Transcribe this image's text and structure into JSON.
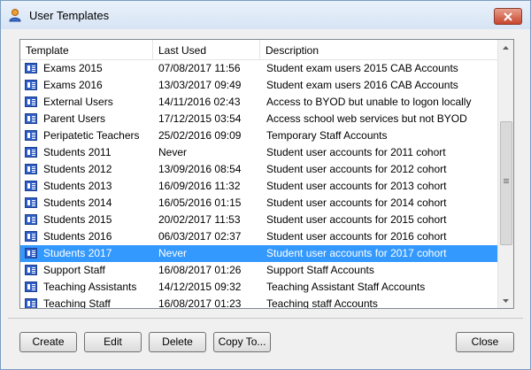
{
  "window": {
    "title": "User Templates"
  },
  "list": {
    "columns": [
      "Template",
      "Last Used",
      "Description"
    ],
    "rows": [
      {
        "template": "Exams 2015",
        "last_used": "07/08/2017 11:56",
        "description": "Student exam users 2015 CAB Accounts"
      },
      {
        "template": "Exams 2016",
        "last_used": "13/03/2017 09:49",
        "description": "Student exam users 2016 CAB Accounts"
      },
      {
        "template": "External Users",
        "last_used": "14/11/2016 02:43",
        "description": "Access to BYOD but unable to logon locally"
      },
      {
        "template": "Parent Users",
        "last_used": "17/12/2015 03:54",
        "description": "Access school web services but not BYOD"
      },
      {
        "template": "Peripatetic Teachers",
        "last_used": "25/02/2016 09:09",
        "description": "Temporary Staff Accounts"
      },
      {
        "template": "Students 2011",
        "last_used": "Never",
        "description": "Student user accounts for 2011 cohort"
      },
      {
        "template": "Students 2012",
        "last_used": "13/09/2016 08:54",
        "description": "Student user accounts for 2012 cohort"
      },
      {
        "template": "Students 2013",
        "last_used": "16/09/2016 11:32",
        "description": "Student user accounts for 2013 cohort"
      },
      {
        "template": "Students 2014",
        "last_used": "16/05/2016 01:15",
        "description": "Student user accounts for 2014 cohort"
      },
      {
        "template": "Students 2015",
        "last_used": "20/02/2017 11:53",
        "description": "Student user accounts for 2015 cohort"
      },
      {
        "template": "Students 2016",
        "last_used": "06/03/2017 02:37",
        "description": "Student user accounts for 2016 cohort"
      },
      {
        "template": "Students 2017",
        "last_used": "Never",
        "description": "Student user accounts for 2017 cohort",
        "selected": true
      },
      {
        "template": "Support Staff",
        "last_used": "16/08/2017 01:26",
        "description": "Support Staff Accounts"
      },
      {
        "template": "Teaching Assistants",
        "last_used": "14/12/2015 09:32",
        "description": "Teaching Assistant Staff Accounts"
      },
      {
        "template": "Teaching Staff",
        "last_used": "16/08/2017 01:23",
        "description": "Teaching staff Accounts"
      }
    ]
  },
  "buttons": {
    "create": "Create",
    "edit": "Edit",
    "delete": "Delete",
    "copy_to": "Copy To...",
    "close": "Close"
  },
  "colors": {
    "selection": "#3399ff",
    "close_button": "#c7452d",
    "row_icon": "#2f5ec7"
  },
  "icons": {
    "title": "user-templates-icon",
    "row": "user-card-icon",
    "close": "close-icon"
  }
}
